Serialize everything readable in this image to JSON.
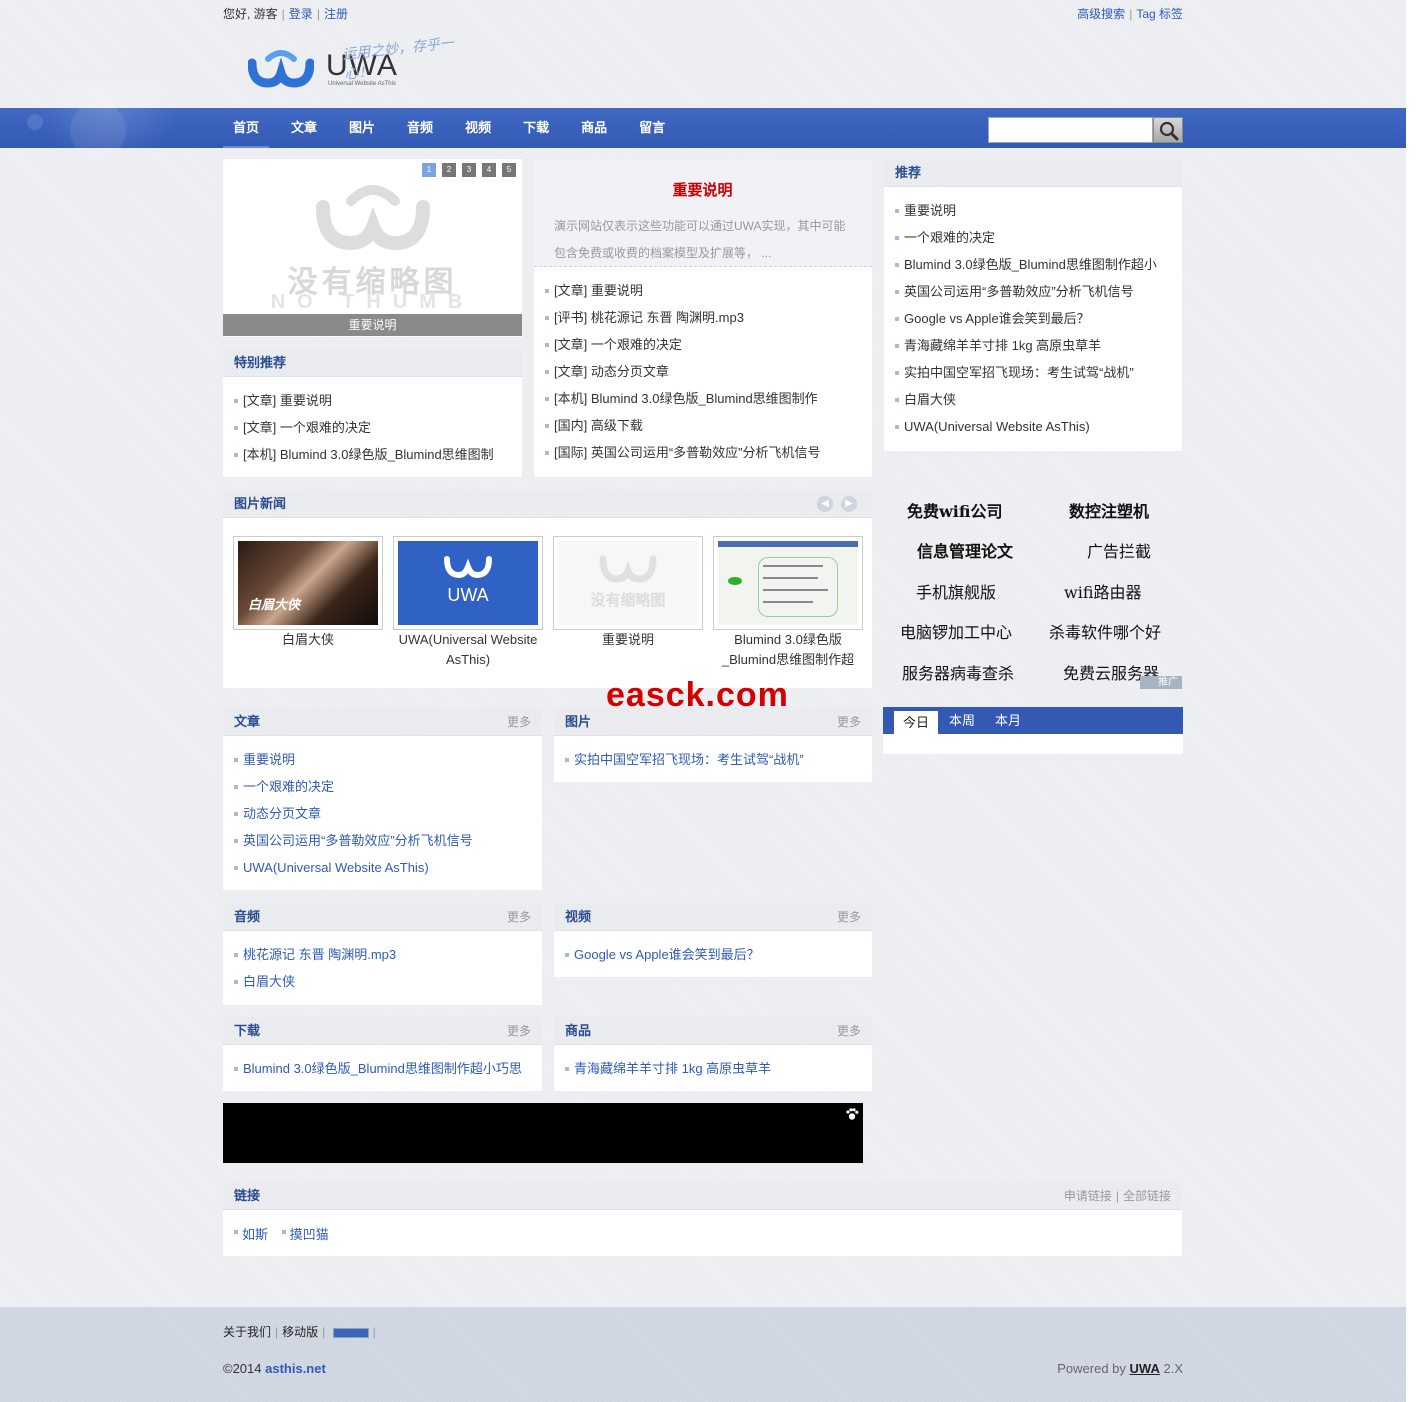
{
  "topbar": {
    "greeting": "您好, 游客",
    "login": "登录",
    "register": "注册",
    "adv_search": "高级搜索",
    "tags": "Tag 标签"
  },
  "logo": {
    "text": "UWA",
    "sub": "Universal Website AsThis",
    "slogan": "运用之妙，存乎一心！"
  },
  "nav": [
    "首页",
    "文章",
    "图片",
    "音频",
    "视频",
    "下载",
    "商品",
    "留言"
  ],
  "slider": {
    "pages": [
      "1",
      "2",
      "3",
      "4",
      "5"
    ],
    "caption": "重要说明",
    "nothumb_cn": "没有缩略图",
    "nothumb_en": "NO THUMB"
  },
  "headline": {
    "title": "重要说明",
    "desc": "演示网站仅表示这些功能可以通过UWA实现，其中可能包含免费或收费的档案模型及扩展等， ..."
  },
  "headline_list": [
    "[文章] 重要说明",
    "[评书] 桃花源记 东晋 陶渊明.mp3",
    "[文章] 一个艰难的决定",
    "[文章] 动态分页文章",
    "[本机] Blumind 3.0绿色版_Blumind思维图制作",
    "[国内] 高级下载",
    "[国际] 英国公司运用“多普勒效应”分析飞机信号"
  ],
  "special": {
    "title": "特别推荐",
    "items": [
      "[文章] 重要说明",
      "[文章] 一个艰难的决定",
      "[本机] Blumind 3.0绿色版_Blumind思维图制"
    ]
  },
  "recommend": {
    "title": "推荐",
    "items": [
      "重要说明",
      "一个艰难的决定",
      "Blumind 3.0绿色版_Blumind思维图制作超小",
      "英国公司运用“多普勒效应”分析飞机信号",
      "Google vs Apple谁会笑到最后？",
      "青海藏绵羊羊寸排 1kg 高原虫草羊",
      "实拍中国空军招飞现场：考生试驾“战机”",
      "白眉大侠",
      "UWA(Universal Website AsThis)"
    ]
  },
  "photonews": {
    "title": "图片新闻",
    "items": [
      {
        "caption": "白眉大侠"
      },
      {
        "caption": "UWA(Universal Website AsThis)"
      },
      {
        "caption": "重要说明"
      },
      {
        "caption": "Blumind 3.0绿色版_Blumind思维图制作超"
      }
    ]
  },
  "ads": {
    "items": [
      "免费wifi公司",
      "数控注塑机",
      "信息管理论文",
      "广告拦截",
      "手机旗舰版",
      "wifi路由器",
      "电脑锣加工中心",
      "杀毒软件哪个好",
      "服务器病毒查杀",
      "免费云服务器"
    ],
    "badge": "推广"
  },
  "rank": {
    "tabs": [
      "今日",
      "本周",
      "本月"
    ]
  },
  "more": "更多",
  "sections": {
    "article": {
      "title": "文章",
      "items": [
        "重要说明",
        "一个艰难的决定",
        "动态分页文章",
        "英国公司运用“多普勒效应”分析飞机信号",
        "UWA(Universal Website AsThis)"
      ]
    },
    "picture": {
      "title": "图片",
      "items": [
        "实拍中国空军招飞现场：考生试驾“战机”"
      ]
    },
    "audio": {
      "title": "音频",
      "items": [
        "桃花源记 东晋 陶渊明.mp3",
        "白眉大侠"
      ]
    },
    "video": {
      "title": "视频",
      "items": [
        "Google vs Apple谁会笑到最后？"
      ]
    },
    "download": {
      "title": "下载",
      "items": [
        "Blumind 3.0绿色版_Blumind思维图制作超小巧思"
      ]
    },
    "goods": {
      "title": "商品",
      "items": [
        "青海藏绵羊羊寸排 1kg 高原虫草羊"
      ]
    }
  },
  "links": {
    "title": "链接",
    "apply": "申请链接",
    "all": "全部链接",
    "items": [
      "如斯",
      "摸凹猫"
    ]
  },
  "footer": {
    "about": "关于我们",
    "mobile": "移动版",
    "copyright": "©2014 ",
    "site": "asthis.net",
    "powered": "Powered by ",
    "brand": "UWA",
    "version": " 2.X"
  },
  "watermark": "easck.com",
  "colors": {
    "nav": "#3359b3",
    "link": "#2f5bb7",
    "title_red": "#cc0000"
  }
}
